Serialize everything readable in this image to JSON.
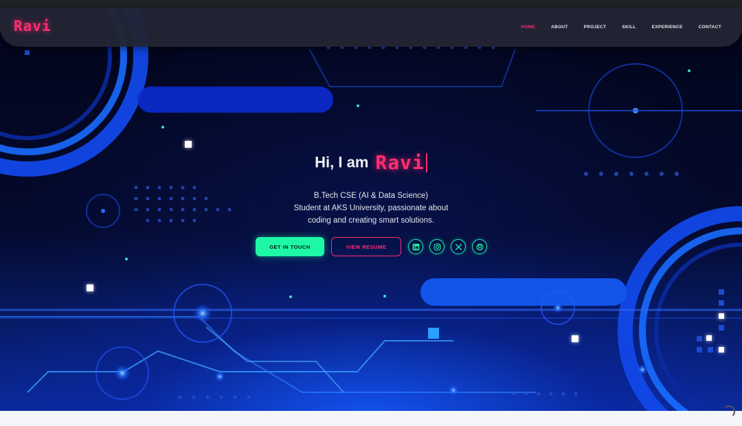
{
  "nav": {
    "logo": "Ravi",
    "items": [
      {
        "label": "HOME",
        "active": true
      },
      {
        "label": "ABOUT",
        "active": false
      },
      {
        "label": "PROJECT",
        "active": false
      },
      {
        "label": "SKILL",
        "active": false
      },
      {
        "label": "EXPERIENCE",
        "active": false
      },
      {
        "label": "CONTACT",
        "active": false
      }
    ]
  },
  "hero": {
    "greeting": "Hi, I am",
    "name": "Ravi",
    "bio_lines": [
      "B.Tech CSE (AI & Data Science)",
      "Student at AKS University, passionate about",
      "coding and creating smart solutions."
    ],
    "primary_button": "GET IN TOUCH",
    "secondary_button": "VIEW RESUME",
    "social_icons": [
      "linkedin-icon",
      "instagram-icon",
      "x-icon",
      "github-icon"
    ]
  },
  "colors": {
    "accent_pink": "#ff2d6e",
    "accent_green": "#1ef7a6",
    "background": "#04061a",
    "navbar": "#222434"
  }
}
